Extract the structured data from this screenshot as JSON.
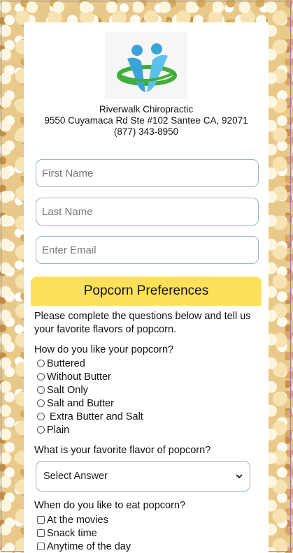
{
  "business": {
    "name": "Riverwalk Chiropractic",
    "address": "9550 Cuyamaca Rd Ste #102 Santee CA, 92071",
    "phone": "(877) 343-8950",
    "logo_icon": "two-figures-swoosh-logo"
  },
  "form": {
    "first_name_placeholder": "First Name",
    "last_name_placeholder": "Last Name",
    "email_placeholder": "Enter Email"
  },
  "section": {
    "title": "Popcorn Preferences",
    "intro": "Please complete the questions below and tell us your favorite flavors of popcorn."
  },
  "q1": {
    "text": "How do you like your popcorn?",
    "options": [
      "Buttered",
      "Without Butter",
      "Salt Only",
      "Salt and Butter",
      " Extra Butter and Salt",
      "Plain"
    ]
  },
  "q2": {
    "text": "What is your favorite flavor of popcorn?",
    "selected": "Select Answer"
  },
  "q3": {
    "text": "When do you like to eat popcorn?",
    "options": [
      "At the movies",
      "Snack time",
      "Anytime of the day"
    ]
  },
  "colors": {
    "header_yellow": "#fde15a",
    "logo_blue": "#3aa3d8",
    "logo_green": "#3fae3a"
  }
}
